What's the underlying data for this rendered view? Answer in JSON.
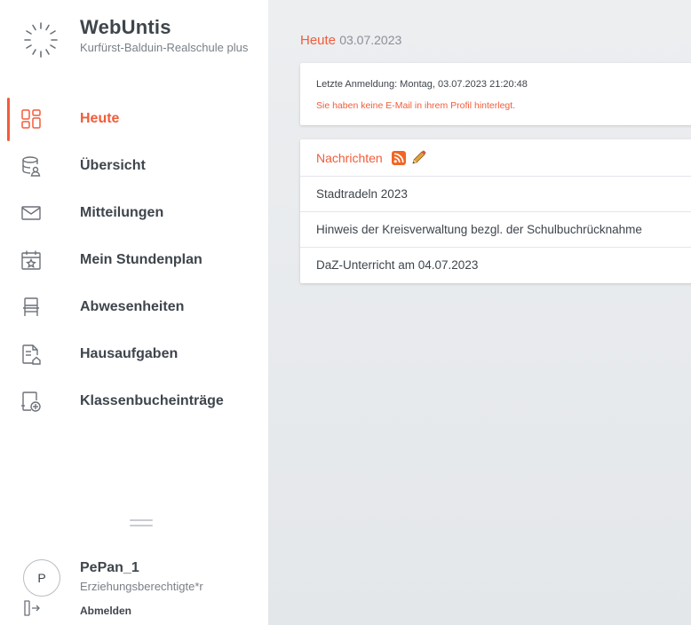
{
  "brand": {
    "name": "WebUntis",
    "school": "Kurfürst-Balduin-Realschule plus",
    "logo_icon": "webuntis-logo-icon"
  },
  "sidebar": {
    "items": [
      {
        "label": "Heute",
        "icon": "dashboard-icon",
        "active": true
      },
      {
        "label": "Übersicht",
        "icon": "overview-icon",
        "active": false
      },
      {
        "label": "Mitteilungen",
        "icon": "envelope-icon",
        "active": false
      },
      {
        "label": "Mein Stundenplan",
        "icon": "calendar-icon",
        "active": false
      },
      {
        "label": "Abwesenheiten",
        "icon": "chair-icon",
        "active": false
      },
      {
        "label": "Hausaufgaben",
        "icon": "homework-icon",
        "active": false
      },
      {
        "label": "Klassenbucheinträge",
        "icon": "classbook-icon",
        "active": false
      }
    ]
  },
  "user": {
    "avatar_initial": "P",
    "name": "PePan_1",
    "role": "Erziehungsberechtigte*r",
    "logout_label": "Abmelden"
  },
  "main": {
    "today_label": "Heute",
    "today_date": "03.07.2023",
    "login_info": "Letzte Anmeldung: Montag, 03.07.2023 21:20:48",
    "email_warning": "Sie haben keine E-Mail in ihrem Profil hinterlegt.",
    "news": {
      "title": "Nachrichten",
      "items": [
        "Stadtradeln 2023",
        "Hinweis der Kreisverwaltung bezgl. der Schulbuchrücknahme",
        "DaZ-Unterricht am 04.07.2023"
      ]
    }
  },
  "colors": {
    "accent": "#f25c3a",
    "text": "#3e454c",
    "muted": "#7a8088",
    "background": "#e9ebee"
  }
}
